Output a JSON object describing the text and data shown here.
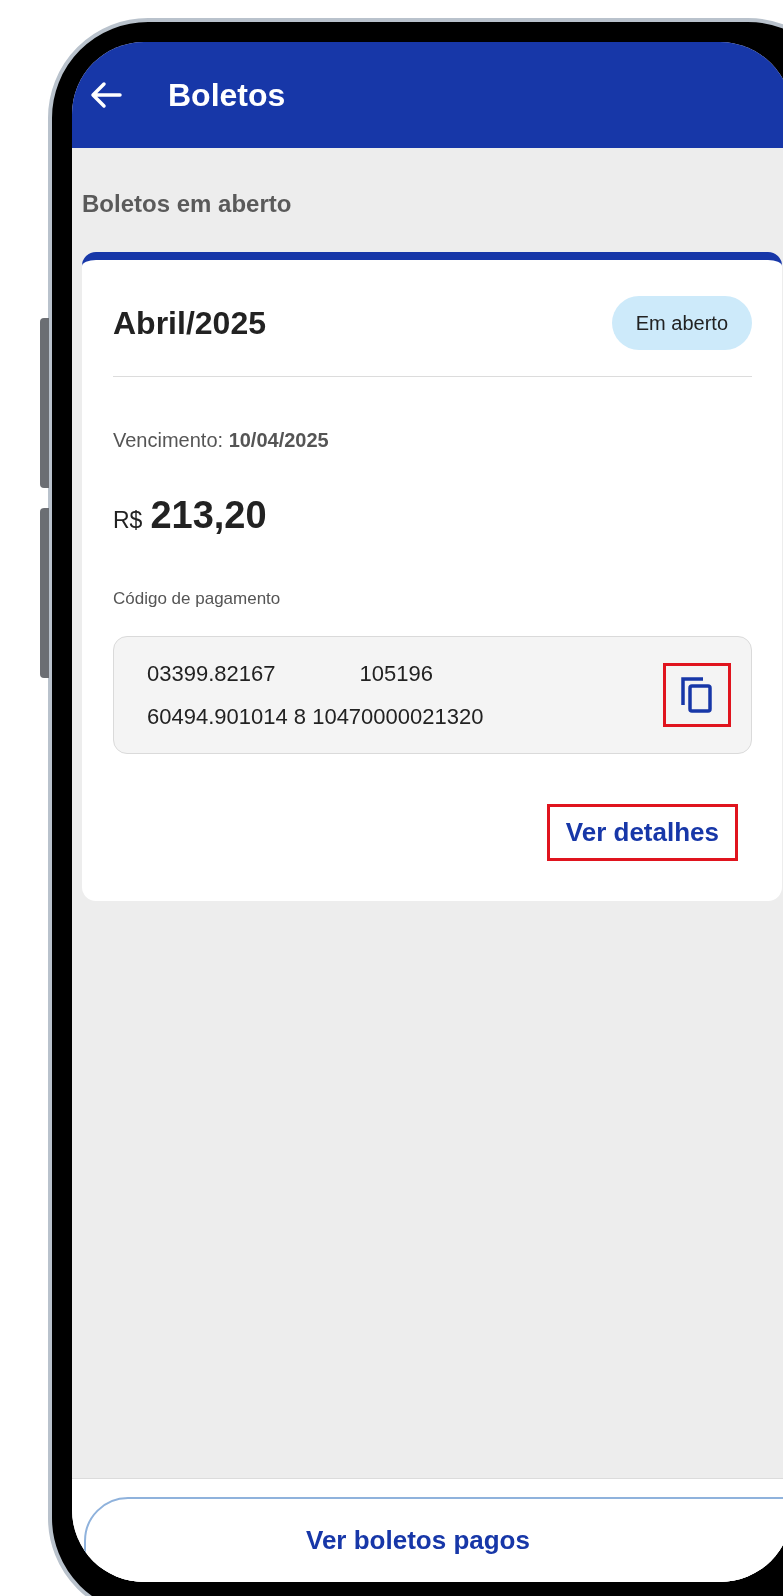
{
  "header": {
    "title": "Boletos"
  },
  "section_title": "Boletos em aberto",
  "boleto": {
    "month": "Abril/2025",
    "status": "Em aberto",
    "due_label": "Vencimento:",
    "due_date": "10/04/2025",
    "currency": "R$",
    "amount": "213,20",
    "code_label": "Código de pagamento",
    "code_lines": [
      [
        "03399.82167",
        "105196"
      ],
      [
        "60494.901014 8 10470000021320"
      ]
    ],
    "copy_highlighted": true,
    "details_link": {
      "label": "Ver detalhes",
      "highlighted": true
    }
  },
  "footer_button": "Ver boletos pagos"
}
